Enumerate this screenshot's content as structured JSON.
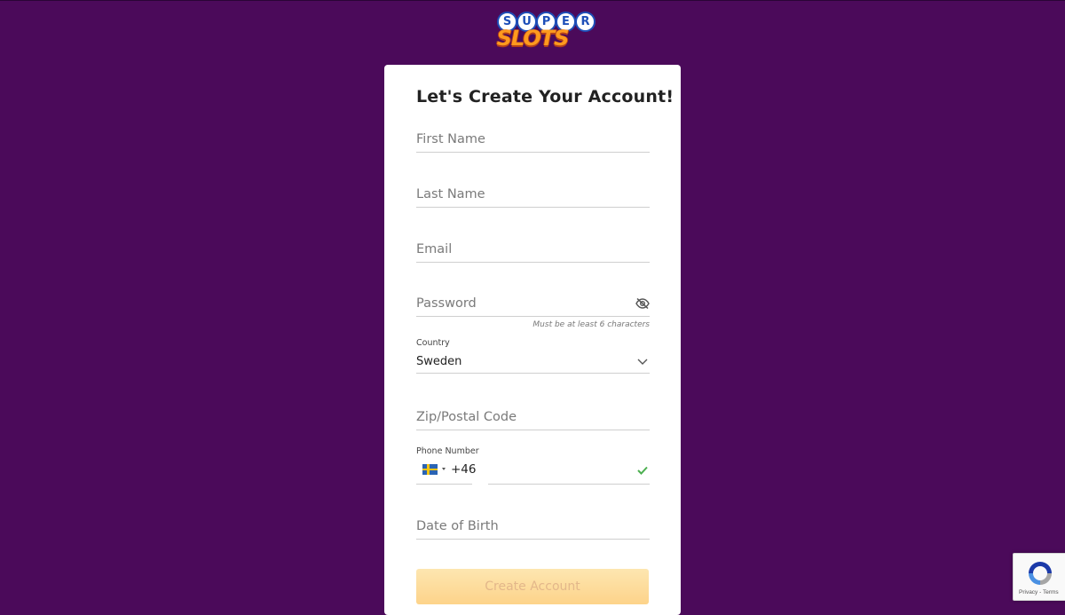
{
  "brand": {
    "logo_top": "SUPER",
    "logo_bottom": "SLOTS",
    "logo_letters": [
      "S",
      "U",
      "P",
      "E",
      "R"
    ]
  },
  "form": {
    "title": "Let's Create Your Account!",
    "first_name_placeholder": "First Name",
    "last_name_placeholder": "Last Name",
    "email_placeholder": "Email",
    "password_placeholder": "Password",
    "password_hint": "Must be at least 6 characters",
    "country_label": "Country",
    "country_value": "Sweden",
    "zip_placeholder": "Zip/Postal Code",
    "phone_label": "Phone Number",
    "phone_prefix": "+46",
    "dob_placeholder": "Date of Birth",
    "submit_label": "Create Account"
  },
  "recaptcha": {
    "links": "Privacy - Terms"
  },
  "icons": {
    "password_toggle": "eye-off-icon",
    "country_dropdown": "chevron-down-icon",
    "phone_valid": "check-icon",
    "flag": "sweden-flag-icon",
    "recaptcha": "recaptcha-icon"
  },
  "colors": {
    "background": "#4b0a5a",
    "card": "#ffffff",
    "button": "#fdd38a",
    "check": "#4caf50"
  }
}
